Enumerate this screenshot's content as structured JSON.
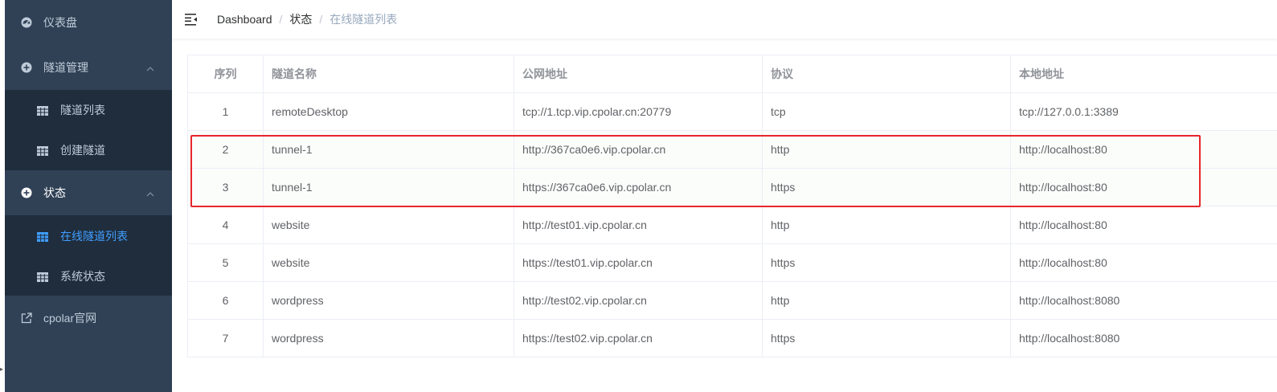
{
  "colors": {
    "sidebar_bg": "#304156",
    "submenu_bg": "#1f2d3d",
    "menu_text": "#bfcbd9",
    "active_text": "#409eff",
    "highlight_border": "#e8262b"
  },
  "sidebar": {
    "dashboard": {
      "label": "仪表盘",
      "icon": "dashboard-icon"
    },
    "tunnel_mgmt": {
      "label": "隧道管理",
      "icon": "plus-circle-icon",
      "expanded": true,
      "items": [
        {
          "label": "隧道列表",
          "icon": "table-icon"
        },
        {
          "label": "创建隧道",
          "icon": "table-icon"
        }
      ]
    },
    "status": {
      "label": "状态",
      "icon": "plus-circle-icon",
      "expanded": true,
      "items": [
        {
          "label": "在线隧道列表",
          "icon": "table-icon",
          "active": true
        },
        {
          "label": "系统状态",
          "icon": "table-icon"
        }
      ]
    },
    "website": {
      "label": "cpolar官网",
      "icon": "external-link-icon"
    }
  },
  "navbar": {
    "breadcrumb": [
      "Dashboard",
      "状态",
      "在线隧道列表"
    ],
    "separator": "/"
  },
  "table": {
    "headers": [
      "序列",
      "隧道名称",
      "公网地址",
      "协议",
      "本地地址"
    ],
    "rows": [
      [
        "1",
        "remoteDesktop",
        "tcp://1.tcp.vip.cpolar.cn:20779",
        "tcp",
        "tcp://127.0.0.1:3389"
      ],
      [
        "2",
        "tunnel-1",
        "http://367ca0e6.vip.cpolar.cn",
        "http",
        "http://localhost:80"
      ],
      [
        "3",
        "tunnel-1",
        "https://367ca0e6.vip.cpolar.cn",
        "https",
        "http://localhost:80"
      ],
      [
        "4",
        "website",
        "http://test01.vip.cpolar.cn",
        "http",
        "http://localhost:80"
      ],
      [
        "5",
        "website",
        "https://test01.vip.cpolar.cn",
        "https",
        "http://localhost:80"
      ],
      [
        "6",
        "wordpress",
        "http://test02.vip.cpolar.cn",
        "http",
        "http://localhost:8080"
      ],
      [
        "7",
        "wordpress",
        "https://test02.vip.cpolar.cn",
        "https",
        "http://localhost:8080"
      ]
    ],
    "highlighted_rows": [
      "2",
      "3"
    ]
  }
}
